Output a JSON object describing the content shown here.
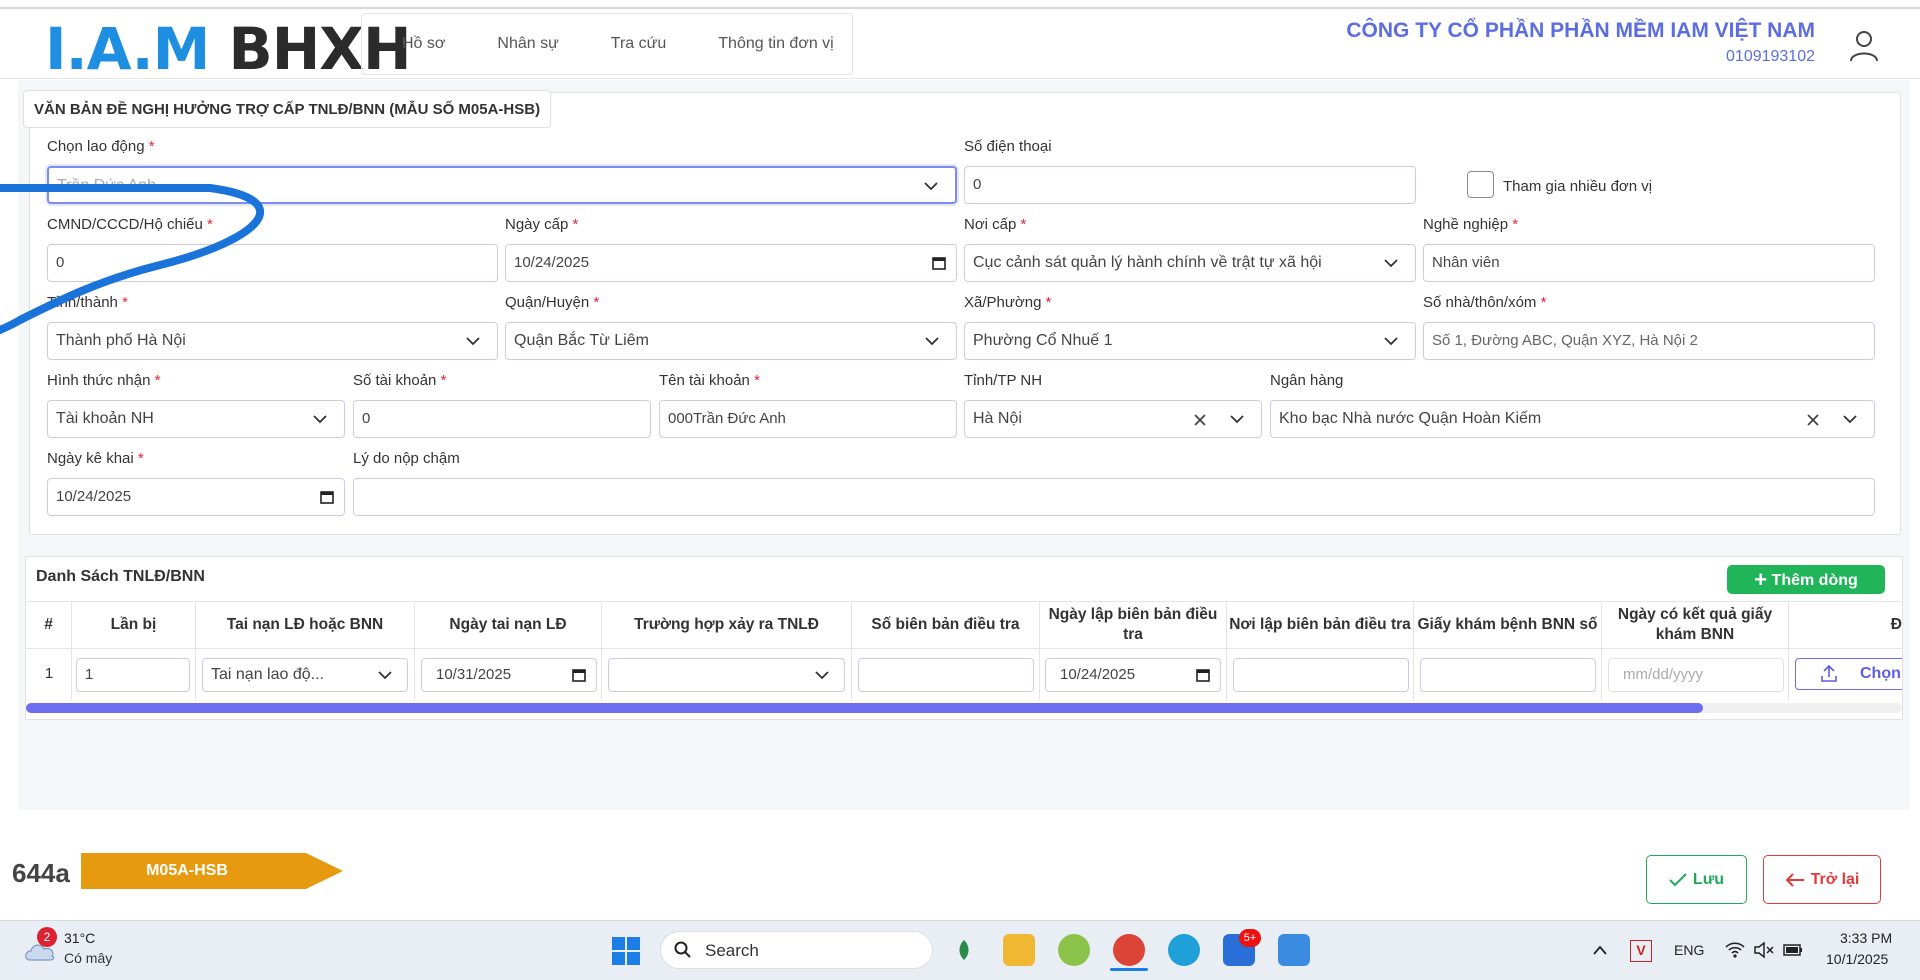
{
  "header": {
    "logo_part1": "I.A.M",
    "logo_part2": "BHXH",
    "nav": [
      "Hồ sơ",
      "Nhân sự",
      "Tra cứu",
      "Thông tin đơn vị"
    ],
    "company_name": "CÔNG TY CỔ PHẦN PHẦN MỀM IAM VIỆT NAM",
    "company_tax": "0109193102"
  },
  "form": {
    "legend": "VĂN BẢN ĐỀ NGHỊ HƯỞNG TRỢ CẤP TNLĐ/BNN (MẪU SỐ M05A-HSB)",
    "required_mark": "*",
    "labels": {
      "chon_lao_dong": "Chọn lao động",
      "so_dien_thoai": "Số điện thoại",
      "cmnd": "CMND/CCCD/Hộ chiếu",
      "ngay_cap": "Ngày cấp",
      "noi_cap": "Nơi cấp",
      "nghe_nghiep": "Nghề nghiệp",
      "tinh_thanh": "Tỉnh/thành",
      "quan_huyen": "Quận/Huyện",
      "xa_phuong": "Xã/Phường",
      "so_nha": "Số nhà/thôn/xóm",
      "hinh_thuc_nhan": "Hình thức nhận",
      "so_tai_khoan": "Số tài khoản",
      "ten_tai_khoan": "Tên tài khoản",
      "tinh_tp_nh": "Tỉnh/TP NH",
      "ngan_hang": "Ngân hàng",
      "ngay_ke_khai": "Ngày kê khai",
      "ly_do_nop_cham": "Lý do nộp chậm"
    },
    "values": {
      "chon_lao_dong": "Trần Đức Anh",
      "so_dien_thoai": "0",
      "tham_gia_nhieu_don_vi": "Tham gia nhiều đơn vị",
      "cmnd": "0",
      "ngay_cap": "10/24/2025",
      "noi_cap": "Cục cảnh sát quản lý hành chính về trật tự xã hội",
      "nghe_nghiep": "Nhân viên",
      "tinh_thanh": "Thành phố Hà Nội",
      "quan_huyen": "Quận Bắc Từ Liêm",
      "xa_phuong": "Phường Cổ Nhuế 1",
      "so_nha": "Số 1, Đường ABC, Quận XYZ, Hà Nội 2",
      "hinh_thuc_nhan": "Tài khoản NH",
      "so_tai_khoan": "0",
      "ten_tai_khoan": "000Trần Đức Anh",
      "tinh_tp_nh": "Hà Nội",
      "ngan_hang": "Kho bạc Nhà nước Quận Hoàn Kiếm",
      "ngay_ke_khai": "10/24/2025",
      "ly_do_nop_cham": ""
    }
  },
  "table": {
    "title": "Danh Sách TNLĐ/BNN",
    "add_button": "Thêm dòng",
    "columns": [
      "#",
      "Lần bị",
      "Tai nạn LĐ hoặc BNN",
      "Ngày tai nạn LĐ",
      "Trường hợp xảy ra TNLĐ",
      "Số biên bản điều tra",
      "Ngày lập biên bản điều tra",
      "Nơi lập biên bản điều tra",
      "Giấy khám bệnh BNN số",
      "Ngày có kết quả giấy khám BNN",
      "Đ"
    ],
    "rows": [
      {
        "index": "1",
        "lan_bi": "1",
        "loai": "Tai nạn lao độ...",
        "ngay_tai_nan": "10/31/2025",
        "truong_hop": "",
        "so_bien_ban": "",
        "ngay_lap": "10/24/2025",
        "noi_lap": "",
        "giay_kham": "",
        "ngay_ket_qua_placeholder": "mm/dd/yyyy",
        "upload_label": "Chọn"
      }
    ]
  },
  "footer": {
    "code": "644a",
    "form_badge": "M05A-HSB",
    "save": "Lưu",
    "back": "Trở lại"
  },
  "taskbar": {
    "weather_badge": "2",
    "temperature": "31°C",
    "condition": "Có mây",
    "search": "Search",
    "zalo_badge": "5+",
    "lang": "ENG",
    "time": "3:33 PM",
    "date": "10/1/2025"
  },
  "colors": {
    "brand_blue": "#1e8fe0",
    "company_text": "#5b6de0",
    "save_green": "#21a95a",
    "back_red": "#e23b3b",
    "badge_orange": "#e59a10",
    "scroll_purple": "#6b6ef0",
    "annotation_stroke": "#1a73d9"
  }
}
